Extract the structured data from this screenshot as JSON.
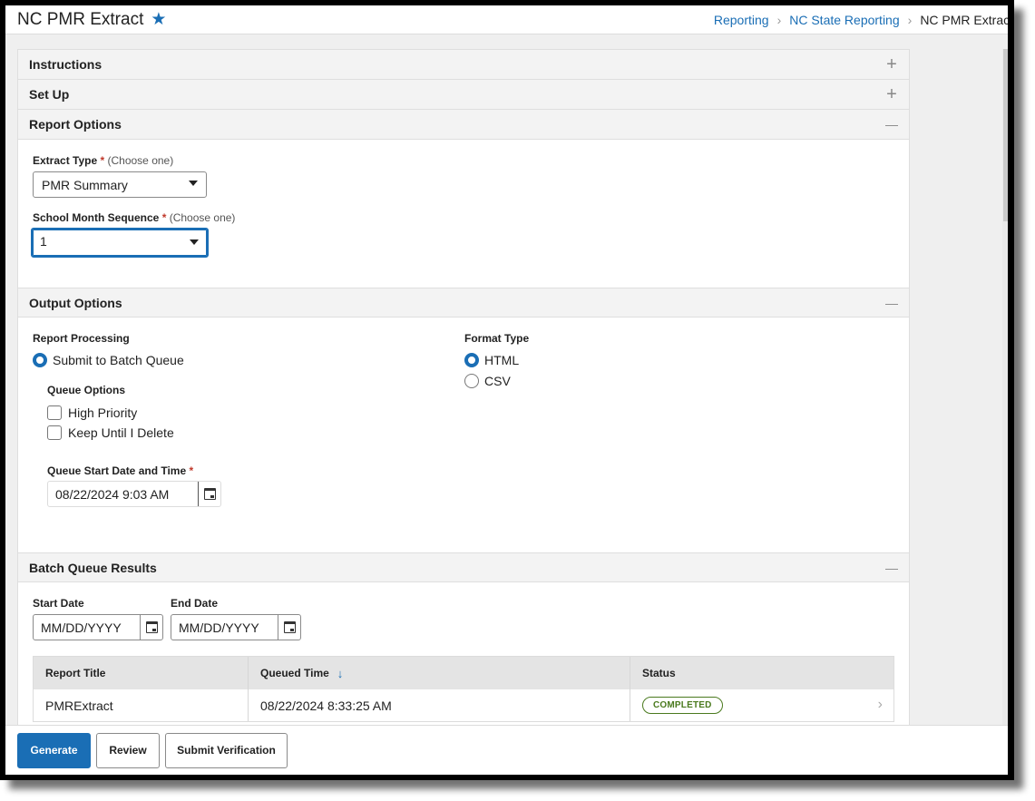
{
  "header": {
    "title": "NC PMR Extract",
    "favorite_icon": "star-icon",
    "breadcrumb": [
      {
        "label": "Reporting"
      },
      {
        "label": "NC State Reporting"
      },
      {
        "label": "NC PMR Extract"
      }
    ]
  },
  "sections": {
    "instructions": {
      "title": "Instructions",
      "toggle": "+"
    },
    "setup": {
      "title": "Set Up",
      "toggle": "+"
    },
    "report_options": {
      "title": "Report Options",
      "toggle": "—"
    },
    "output_options": {
      "title": "Output Options",
      "toggle": "—"
    },
    "batch_queue": {
      "title": "Batch Queue Results",
      "toggle": "—"
    }
  },
  "report_options": {
    "extract_type": {
      "label": "Extract Type",
      "required": "*",
      "hint": "(Choose one)",
      "value": "PMR Summary"
    },
    "school_month": {
      "label": "School Month Sequence",
      "required": "*",
      "hint": "(Choose one)",
      "value": "1"
    }
  },
  "output_options": {
    "report_processing": {
      "label": "Report Processing",
      "option": "Submit to Batch Queue",
      "selected": true
    },
    "queue_options": {
      "label": "Queue Options",
      "items": [
        {
          "label": "High Priority",
          "checked": false
        },
        {
          "label": "Keep Until I Delete",
          "checked": false
        }
      ]
    },
    "queue_start": {
      "label": "Queue Start Date and Time",
      "required": "*",
      "value": "08/22/2024 9:03 AM"
    },
    "format_type": {
      "label": "Format Type",
      "options": [
        {
          "label": "HTML",
          "selected": true
        },
        {
          "label": "CSV",
          "selected": false
        }
      ]
    }
  },
  "batch_queue": {
    "start_date": {
      "label": "Start Date",
      "placeholder": "MM/DD/YYYY"
    },
    "end_date": {
      "label": "End Date",
      "placeholder": "MM/DD/YYYY"
    },
    "table": {
      "columns": [
        "Report Title",
        "Queued Time",
        "Status"
      ],
      "sort_indicator": "↓",
      "rows": [
        {
          "title": "PMRExtract",
          "queued": "08/22/2024 8:33:25 AM",
          "status": "COMPLETED"
        }
      ]
    }
  },
  "footer": {
    "generate": "Generate",
    "review": "Review",
    "submit_verification": "Submit Verification"
  },
  "colors": {
    "accent": "#1a6eb5",
    "status_completed": "#4a7a1e",
    "required": "#c0392b"
  }
}
